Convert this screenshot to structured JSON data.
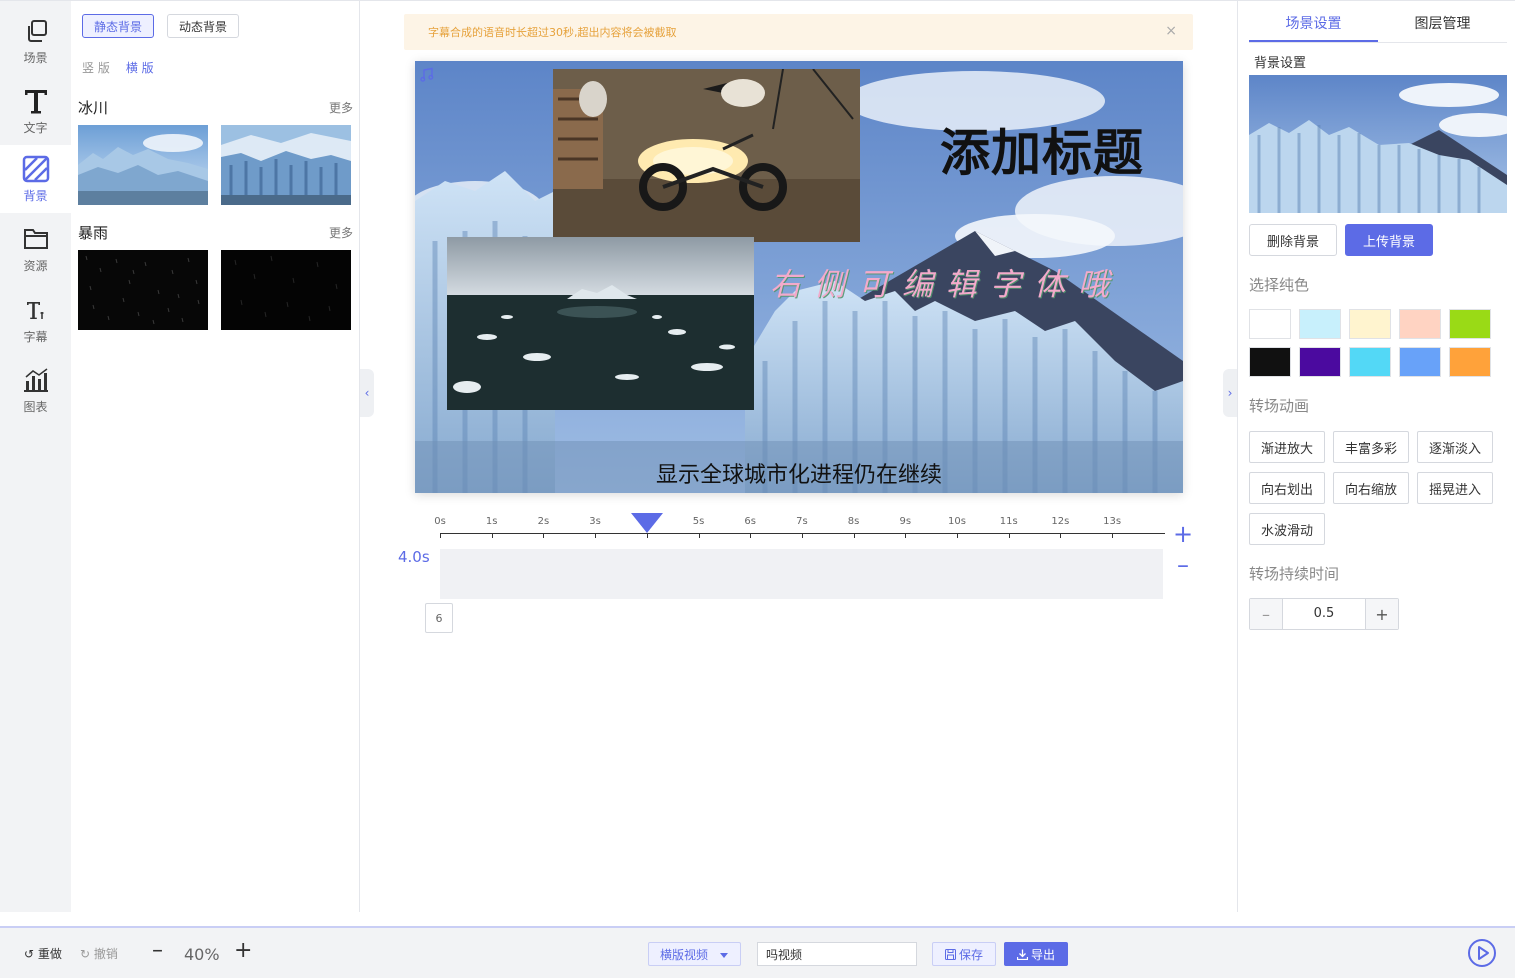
{
  "rail": {
    "items": [
      {
        "label": "场景",
        "icon": "copy-icon"
      },
      {
        "label": "文字",
        "icon": "text-icon"
      },
      {
        "label": "背景",
        "icon": "background-icon"
      },
      {
        "label": "资源",
        "icon": "folder-icon"
      },
      {
        "label": "字幕",
        "icon": "subtitle-icon"
      },
      {
        "label": "图表",
        "icon": "chart-icon"
      }
    ],
    "active": "背景"
  },
  "library": {
    "tabs": [
      "静态背景",
      "动态背景"
    ],
    "active_tab": "静态背景",
    "orientations": [
      "竖 版",
      "横 版"
    ],
    "active_orientation": "横 版",
    "categories": [
      {
        "title": "冰川",
        "more": "更多"
      },
      {
        "title": "暴雨",
        "more": "更多"
      }
    ]
  },
  "notice": {
    "text": "字幕合成的语音时长超过30秒,超出内容将会被截取",
    "close": "×"
  },
  "canvas": {
    "title": "添加标题",
    "decorative_text": "右侧可编辑字体哦",
    "subtitle": "显示全球城市化进程仍在继续"
  },
  "timeline": {
    "ticks": [
      "0s",
      "1s",
      "2s",
      "3s",
      "4s",
      "5s",
      "6s",
      "7s",
      "8s",
      "9s",
      "10s",
      "11s",
      "12s",
      "13s"
    ],
    "playhead_seconds": 4,
    "duration_label": "4.0s",
    "scene_index": "6"
  },
  "props": {
    "tabs": [
      "场景设置",
      "图层管理"
    ],
    "active_tab": "场景设置",
    "bg_label": "背景设置",
    "delete_bg": "删除背景",
    "upload_bg": "上传背景",
    "solid_label": "选择纯色",
    "colors": [
      "#ffffff",
      "#c8f0fc",
      "#fff4cf",
      "#ffd3c2",
      "#9ada16",
      "#111111",
      "#4b0a9f",
      "#53d8f6",
      "#68a2f9",
      "#ffa23a"
    ],
    "transition_label": "转场动画",
    "transitions": [
      "渐进放大",
      "丰富多彩",
      "逐渐淡入",
      "向右划出",
      "向右缩放",
      "摇晃进入",
      "水波滑动"
    ],
    "duration_label": "转场持续时间",
    "duration_value": "0.5"
  },
  "bottom": {
    "undo": "重做",
    "redo": "撤销",
    "zoom": "40%",
    "layout_select": "横版视频",
    "name_value": "吗视频",
    "save": "保存",
    "export": "导出"
  },
  "accent_color": "#5c6be6"
}
